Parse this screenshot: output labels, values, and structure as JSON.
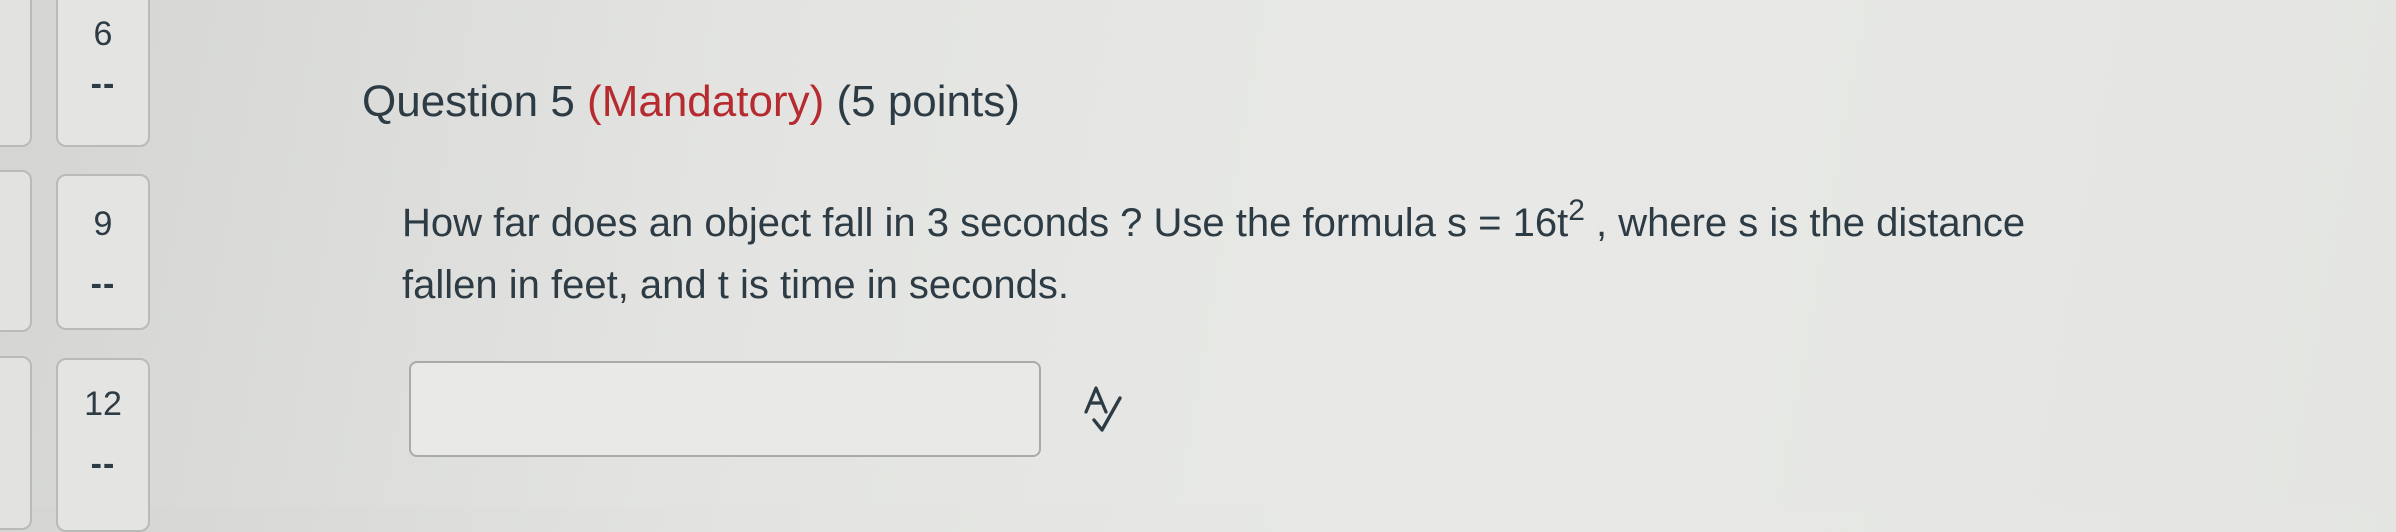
{
  "question_nav": {
    "items": [
      {
        "number": "6",
        "status": "--"
      },
      {
        "number": "9",
        "status": "--"
      },
      {
        "number": "12",
        "status": "--"
      }
    ]
  },
  "question": {
    "title_prefix": "Question 5",
    "mandatory_label": "(Mandatory)",
    "points_label": "(5 points)",
    "text_part1": "How far does an object fall in 3 seconds ? Use the formula s = 16t",
    "exponent": "2",
    "text_part2": " , where s is the distance fallen in feet, and t is time in seconds.",
    "answer_value": "",
    "answer_placeholder": ""
  },
  "icons": {
    "spellcheck": "spellcheck-icon"
  },
  "colors": {
    "mandatory": "#b62b30",
    "text": "#2d3b45"
  }
}
